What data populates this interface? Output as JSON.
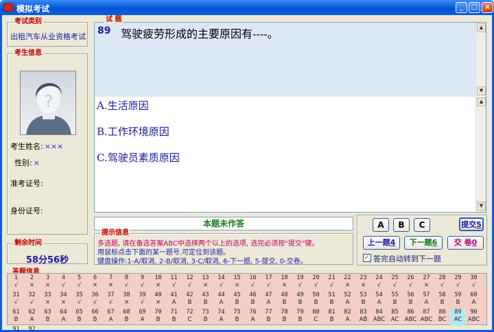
{
  "window": {
    "title": "模拟考试",
    "min": "_",
    "max": "□",
    "close": "×"
  },
  "exam_category": {
    "label": "考试类别",
    "value": "出租汽车从业资格考试"
  },
  "candidate": {
    "label": "考生信息",
    "name_label": "考生姓名:",
    "name_value": "×××",
    "gender_label": "性别:",
    "gender_value": "×",
    "ticket_label": "准考证号:",
    "ticket_value": "",
    "id_label": "身份证号:",
    "id_value": ""
  },
  "time_left": {
    "label": "剩余时间",
    "value": "58分56秒"
  },
  "question": {
    "tag": "试 题",
    "number": "89",
    "text": "驾驶疲劳形成的主要原因有----。",
    "options": [
      "A.生活原因",
      "B.工作环境原因",
      "C.驾驶员素质原因"
    ]
  },
  "status": "本题未作答",
  "hint": {
    "label": "提示信息",
    "line1": "多选题, 请在备选答案ABC中选择两个以上的选项, 选完必须按\"提交\"键。",
    "line2": "用鼠标点击下面的某一题号,可定位到该题。",
    "line3": "键盘操作:1-A/取消, 2-B/取消, 3-C/取消, 6-下一题, 5-提交, 0-交卷。"
  },
  "buttons": {
    "a": "A",
    "b": "B",
    "c": "C",
    "submit": "提交",
    "submit_key": "5",
    "prev": "上一题",
    "prev_key": "4",
    "next": "下一题",
    "next_key": "6",
    "finish": "交 卷",
    "finish_key": "0"
  },
  "auto_next": {
    "label": "答完自动转到下一题",
    "checked": true
  },
  "answers": {
    "label": "答题信息",
    "current": 89,
    "marks": [
      "√",
      "×",
      "×",
      "√",
      "√",
      "×",
      "×",
      "√",
      "√",
      "×",
      "√",
      "√",
      "×",
      "√",
      "×",
      "√",
      "√",
      "×",
      "√",
      "√",
      "√",
      "×",
      "×",
      "√",
      "√",
      "√",
      "×",
      "√",
      "√",
      "√",
      "√",
      "√",
      "×",
      "×",
      "√",
      "√",
      "√",
      "×",
      "√",
      "×",
      "A",
      "B",
      "B",
      "A",
      "B",
      "B",
      "A",
      "B",
      "B",
      "B",
      "B",
      "A",
      "B",
      "A",
      "B",
      "B",
      "A",
      "B",
      "B",
      "A",
      "B",
      "A",
      "B",
      "A",
      "B",
      "B",
      "A",
      "B",
      "A",
      "B",
      "B",
      "C",
      "B",
      "A",
      "B",
      "A",
      "B",
      "B",
      "B",
      "C",
      "B",
      "A",
      "AB",
      "ABC",
      "AC",
      "ABC",
      "ABC",
      "BC",
      "AC",
      "ABC",
      "",
      ""
    ]
  }
}
